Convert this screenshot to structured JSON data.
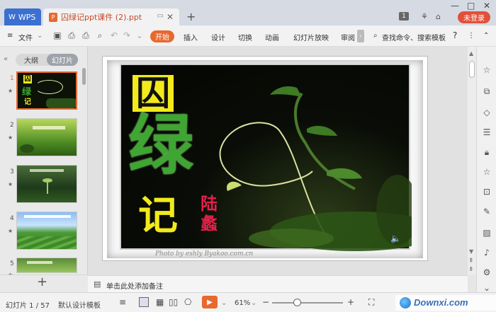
{
  "title_bar": {
    "app_tab_label": "WPS",
    "doc_tab_label": "囚绿记ppt课件 (2).ppt",
    "doc_tab_icon": "P",
    "new_tab": "+",
    "page_badge": "1",
    "login_label": "未登录"
  },
  "menu": {
    "file_label": "文件",
    "start_label": "开始",
    "tabs": [
      "插入",
      "设计",
      "切换",
      "动画",
      "幻灯片放映",
      "审阅"
    ],
    "search_label": "查找命令、搜索模板",
    "help": "?"
  },
  "left_pane": {
    "outline_label": "大纲",
    "slides_label": "幻灯片",
    "thumbs": [
      {
        "num": "1",
        "title": ""
      },
      {
        "num": "2",
        "title": ""
      },
      {
        "num": "3",
        "title": ""
      },
      {
        "num": "4",
        "title": ""
      },
      {
        "num": "5",
        "title": ""
      }
    ],
    "add_slide": "+"
  },
  "slide": {
    "title_char_1": "囚",
    "title_char_2": "绿",
    "title_char_3": "记",
    "author_1": "陆",
    "author_2": "蠡",
    "watermark": "Photo by eshly Byakoo.com.cn"
  },
  "notes": {
    "placeholder": "单击此处添加备注"
  },
  "status": {
    "slide_counter": "幻灯片 1 / 57",
    "template": "默认设计模板",
    "zoom": "61%",
    "zoom_level": 0.61
  },
  "overlay": {
    "brand": "Downxi.com"
  },
  "colors": {
    "accent": "#e8682e",
    "app_blue": "#3b6fd0",
    "title_yellow": "#f2ea1a",
    "title_green": "#3fa533",
    "author_red": "#e4204a"
  }
}
